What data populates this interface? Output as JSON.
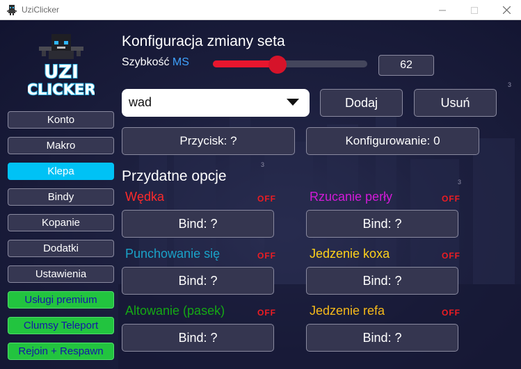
{
  "window": {
    "title": "UziClicker",
    "controls": {
      "minimize": "—",
      "maximize": "☐",
      "close": "✕"
    }
  },
  "logo": {
    "line1": "UZI",
    "line2": "CLICKER"
  },
  "sidebar": {
    "items": [
      {
        "label": "Konto",
        "style": "normal"
      },
      {
        "label": "Makro",
        "style": "normal"
      },
      {
        "label": "Klepa",
        "style": "active"
      },
      {
        "label": "Bindy",
        "style": "normal"
      },
      {
        "label": "Kopanie",
        "style": "normal"
      },
      {
        "label": "Dodatki",
        "style": "normal"
      },
      {
        "label": "Ustawienia",
        "style": "normal"
      },
      {
        "label": "Usługi premium",
        "style": "premium"
      },
      {
        "label": "Clumsy Teleport",
        "style": "premium"
      },
      {
        "label": "Rejoin + Respawn",
        "style": "premium"
      }
    ]
  },
  "config": {
    "title": "Konfiguracja zmiany seta",
    "speed_label": "Szybkość",
    "speed_unit": "MS",
    "speed_value": "62",
    "slider_fraction": 0.42,
    "dropdown_value": "wad",
    "add_button": "Dodaj",
    "remove_button": "Usuń",
    "key_button": "Przycisk: ?",
    "configuring_button": "Konfigurowanie: 0",
    "stray_text": "3"
  },
  "useful": {
    "title": "Przydatne opcje",
    "stray_text_1": "3",
    "stray_text_2": "3",
    "options": [
      {
        "label": "Wędka",
        "color": "#ff2a2a",
        "state": "OFF",
        "bind": "Bind: ?"
      },
      {
        "label": "Rzucanie perły",
        "color": "#d21ad8",
        "state": "OFF",
        "bind": "Bind: ?"
      },
      {
        "label": "Punchowanie się",
        "color": "#1aa2c8",
        "state": "OFF",
        "bind": "Bind: ?"
      },
      {
        "label": "Jedzenie koxa",
        "color": "#ffd21a",
        "state": "OFF",
        "bind": "Bind: ?"
      },
      {
        "label": "Altowanie (pasek)",
        "color": "#15a815",
        "state": "OFF",
        "bind": "Bind: ?"
      },
      {
        "label": "Jedzenie refa",
        "color": "#f5b91a",
        "state": "OFF",
        "bind": "Bind: ?"
      }
    ]
  },
  "colors": {
    "accent_active": "#00c2f5",
    "premium_green": "#22c43f",
    "slider_red": "#e8162e",
    "off_red": "#f01c22",
    "ms_blue": "#3fa3ff"
  }
}
